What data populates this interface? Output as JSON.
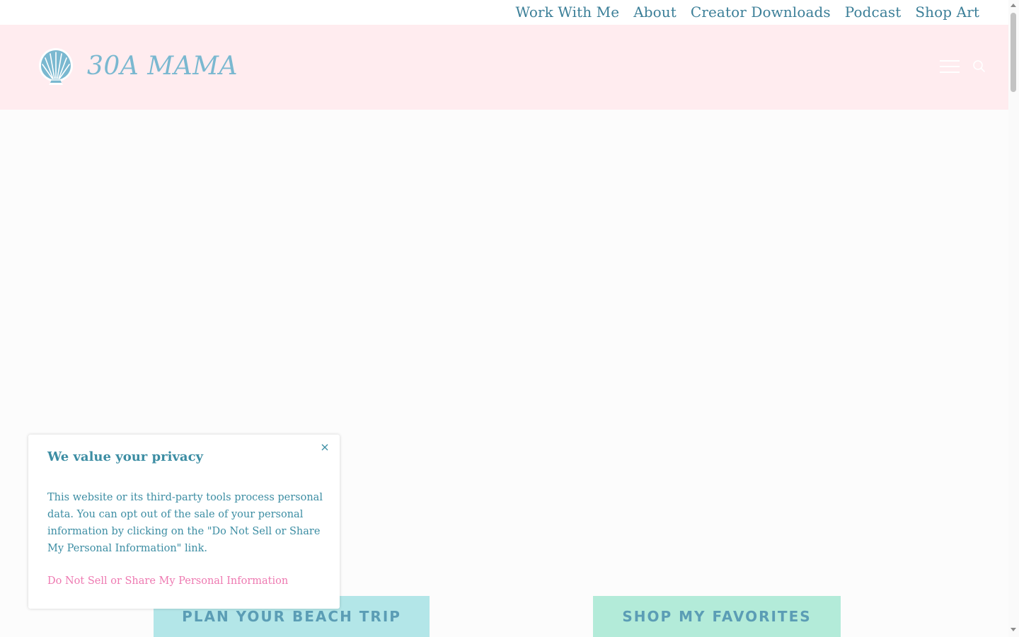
{
  "top_nav": {
    "items": [
      {
        "label": "Work With Me"
      },
      {
        "label": "About"
      },
      {
        "label": "Creator Downloads"
      },
      {
        "label": "Podcast"
      },
      {
        "label": "Shop Art"
      }
    ]
  },
  "header": {
    "site_title": "30A MAMA",
    "logo_icon": "seashell-icon",
    "menu_icon": "hamburger-menu-icon",
    "search_icon": "search-icon"
  },
  "cta": {
    "beach_trip": "PLAN YOUR BEACH TRIP",
    "shop_favorites": "SHOP MY FAVORITES"
  },
  "privacy": {
    "title": "We value your privacy",
    "body": "This website or its third-party tools process personal data. You can opt out of the sale of your personal information by clicking on the \"Do Not Sell or Share My Personal Information\" link.",
    "link": "Do Not Sell or Share My Personal Information",
    "close_icon": "close-icon"
  },
  "colors": {
    "header_bg": "#ffecef",
    "nav_text": "#3c7f98",
    "title_text": "#7ab8d0",
    "privacy_text": "#3c8da3",
    "privacy_link": "#ee79b1",
    "cta_beach_bg": "#b3e6e8",
    "cta_shop_bg": "#b3ebd9"
  }
}
